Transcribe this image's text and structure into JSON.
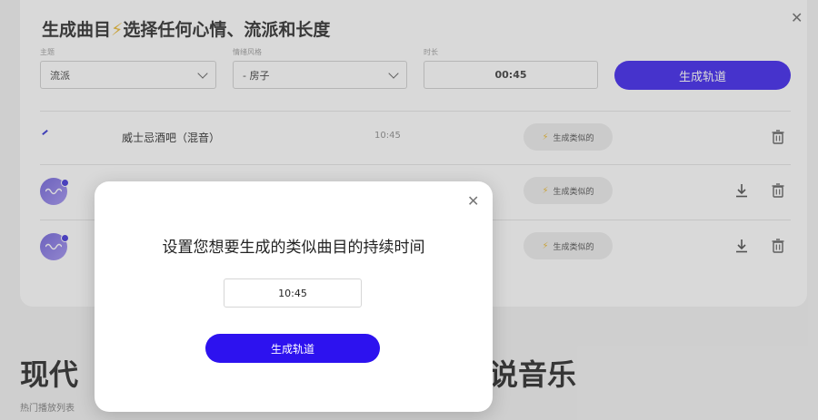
{
  "panel": {
    "title": "生成曲目",
    "title_suffix": "选择任何心情、流派和长度",
    "genre_select": {
      "label": "主题",
      "value": "流派"
    },
    "mood_select": {
      "label": "情绪风格",
      "value": "- 房子"
    },
    "duration": {
      "label": "时长",
      "value": "00:45"
    },
    "generate_button": "生成轨道"
  },
  "tracks": [
    {
      "title": "威士忌酒吧（混音）",
      "time": "10:45",
      "similar_label": "生成类似的"
    },
    {
      "title": "",
      "time": "",
      "similar_label": "生成类似的"
    },
    {
      "title": "",
      "time": "",
      "similar_label": "生成类似的"
    }
  ],
  "section": {
    "heading_left": "现代",
    "heading_right": "说音乐",
    "playlist_label": "热门播放列表"
  },
  "modal": {
    "title": "设置您想要生成的类似曲目的持续时间",
    "duration_value": "10:45",
    "generate_button": "生成轨道"
  },
  "colors": {
    "accent": "#3419ee",
    "bolt": "#e9b526"
  }
}
